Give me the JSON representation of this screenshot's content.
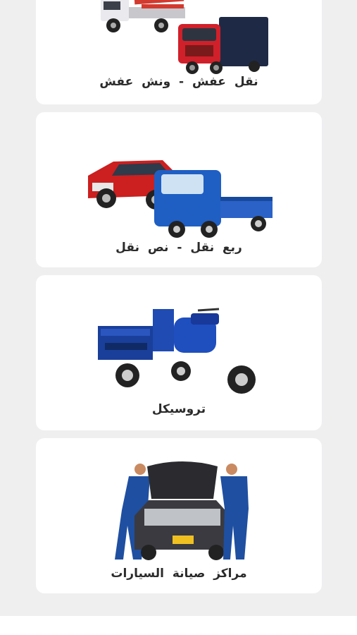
{
  "services": [
    {
      "label": "نقل عفش - ونش عفش",
      "image": "truck-icon"
    },
    {
      "label": "ربع نقل - نص نقل",
      "image": "pickup-icon"
    },
    {
      "label": "تروسيكل",
      "image": "tricycle-icon"
    },
    {
      "label": "مراكز صيانة السيارات",
      "image": "car-service-icon"
    }
  ],
  "colors": {
    "background": "#efeff0",
    "card": "#ffffff",
    "text": "#2b2b2b",
    "truck_red": "#d0202a",
    "pickup_blue": "#1f5fc4",
    "tricycle_blue": "#1a3f9a"
  }
}
